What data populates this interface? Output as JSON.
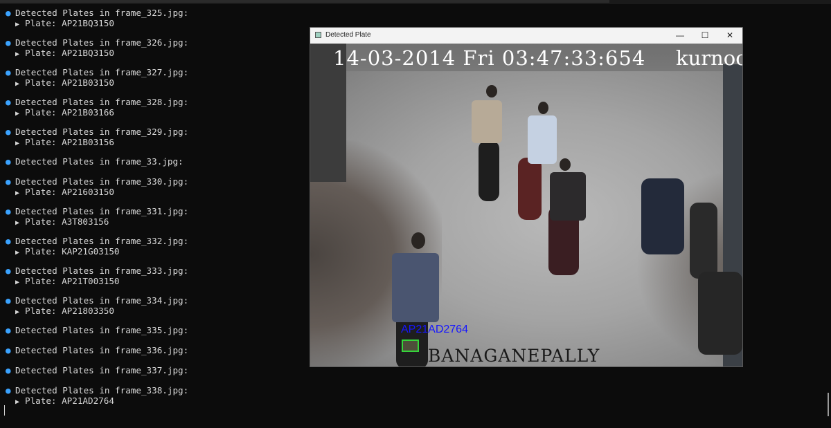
{
  "terminal": {
    "entries": [
      {
        "heading": "Detected Plates in frame_325.jpg:",
        "plate": "Plate: AP21BQ3150"
      },
      {
        "heading": "Detected Plates in frame_326.jpg:",
        "plate": "Plate: AP21BQ3150"
      },
      {
        "heading": "Detected Plates in frame_327.jpg:",
        "plate": "Plate: AP21B03150"
      },
      {
        "heading": "Detected Plates in frame_328.jpg:",
        "plate": "Plate: AP21B03166"
      },
      {
        "heading": "Detected Plates in frame_329.jpg:",
        "plate": "Plate: AP21B03156"
      },
      {
        "heading": "Detected Plates in frame_33.jpg:",
        "plate": ""
      },
      {
        "heading": "Detected Plates in frame_330.jpg:",
        "plate": "Plate: AP21603150"
      },
      {
        "heading": "Detected Plates in frame_331.jpg:",
        "plate": "Plate: A3T803156"
      },
      {
        "heading": "Detected Plates in frame_332.jpg:",
        "plate": "Plate: KAP21G03150"
      },
      {
        "heading": "Detected Plates in frame_333.jpg:",
        "plate": "Plate: AP21T003150"
      },
      {
        "heading": "Detected Plates in frame_334.jpg:",
        "plate": "Plate: AP21803350"
      },
      {
        "heading": "Detected Plates in frame_335.jpg:",
        "plate": ""
      },
      {
        "heading": "Detected Plates in frame_336.jpg:",
        "plate": ""
      },
      {
        "heading": "Detected Plates in frame_337.jpg:",
        "plate": ""
      },
      {
        "heading": "Detected Plates in frame_338.jpg:",
        "plate": "Plate: AP21AD2764"
      }
    ],
    "icon_heading": "magnifier-icon",
    "icon_plate": "triangle-right-icon",
    "heading_icon_color": "#3ba3ff"
  },
  "window": {
    "title": "Detected Plate",
    "controls": {
      "minimize": "—",
      "maximize": "☐",
      "close": "✕"
    },
    "frame": {
      "timestamp": "14-03-2014 Fri 03:47:33:654",
      "location": "kurnoo",
      "bottom_text": "BANAGANEPALLY",
      "detected_plate_label": "AP21AD2764",
      "plate_box_color": "#35d43a",
      "label_color": "#1616ff"
    }
  }
}
